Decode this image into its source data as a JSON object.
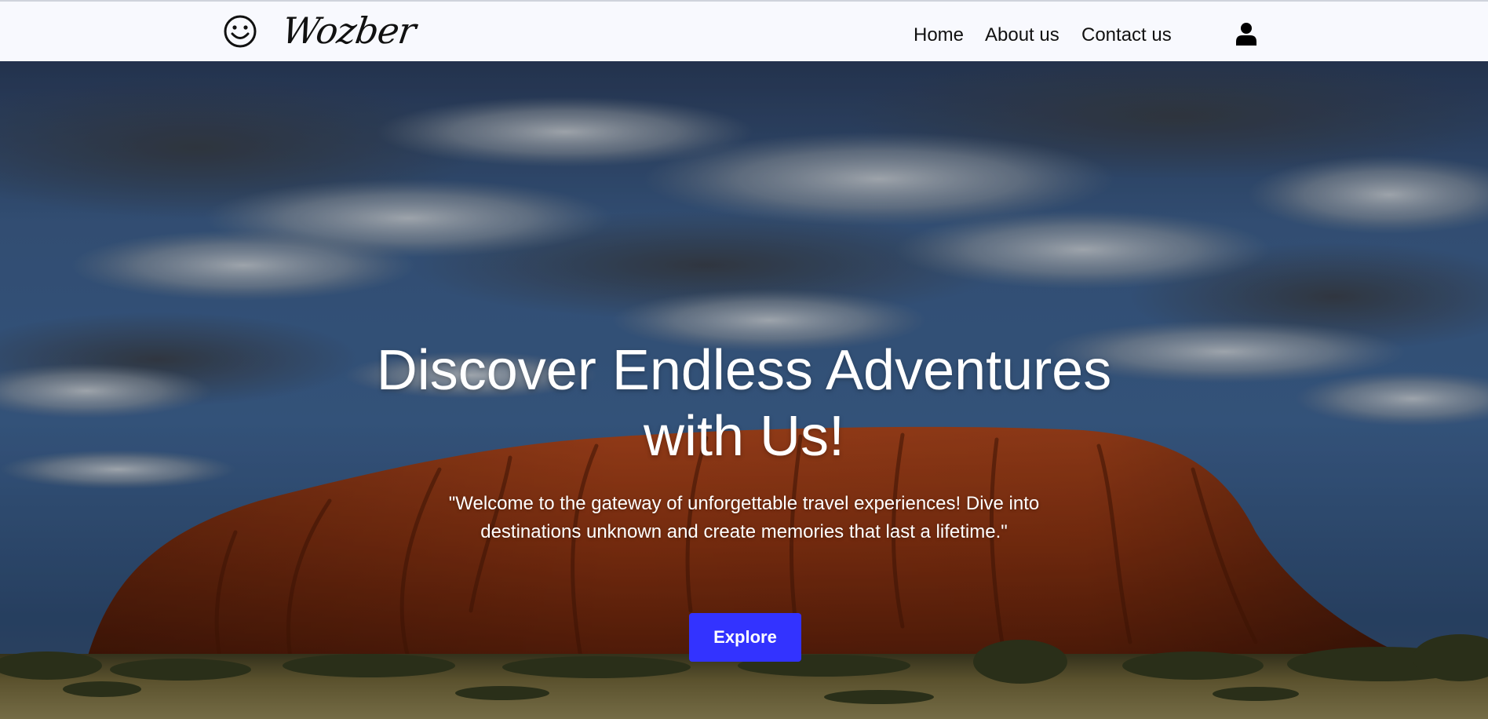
{
  "header": {
    "logo_icon": "smiley-face-icon",
    "brand_name": "Wozber",
    "nav": [
      {
        "label": "Home"
      },
      {
        "label": "About us"
      },
      {
        "label": "Contact us"
      }
    ],
    "user_icon": "user-account-icon"
  },
  "hero": {
    "title_line1": "Discover Endless Adventures",
    "title_line2": "with Us!",
    "subtitle_line1": "\"Welcome to the gateway of unforgettable travel experiences! Dive into",
    "subtitle_line2": "destinations unknown and create memories that last a lifetime.\"",
    "button_label": "Explore",
    "button_color": "#3333ff",
    "background_image": "red sandstone monolith under cloudy blue sky"
  },
  "colors": {
    "header_bg": "#f8f9fe",
    "text_dark": "#111111",
    "hero_text": "#ffffff",
    "accent": "#3333ff"
  }
}
